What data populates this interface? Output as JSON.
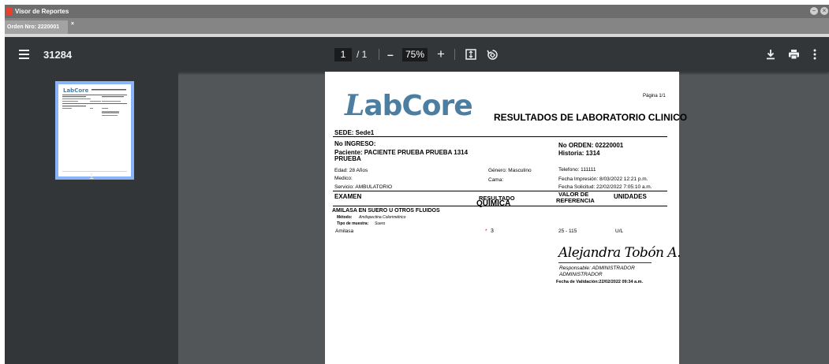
{
  "window": {
    "title": "Visor de Reportes",
    "tab": "Orden Nro: 2220001",
    "tab_close": "×",
    "minimize": "–",
    "close": "×"
  },
  "toolbar": {
    "doc_title": "31284",
    "page_current": "1",
    "page_total": "/ 1",
    "zoom_out": "–",
    "zoom_value": "75%",
    "zoom_in": "+",
    "fit_icon": "fit-page-icon",
    "rotate_icon": "rotate-icon",
    "download_icon": "download-icon",
    "print_icon": "print-icon",
    "more_icon": "more-vert-icon"
  },
  "sidebar": {
    "thumb_number": "1"
  },
  "report": {
    "page_label": "Página 1/1",
    "logo": "LabCore",
    "heading": "RESULTADOS DE LABORATORIO CLINICO",
    "sede": "SEDE: Sede1",
    "no_ingreso": "No INGRESO:",
    "no_orden": "No ORDEN: 02220001",
    "paciente_line1": "Paciente: PACIENTE PRUEBA  PRUEBA  1314",
    "paciente_line2": "PRUEBA",
    "historia": "Historia: 1314",
    "edad": "Edad: 28 Años",
    "genero": "Género: Masculino",
    "telefono": "Telefono: 111111",
    "medico": "Medico:",
    "cama": "Cama:",
    "fecha_impresion": "Fecha Impresión: 8/03/2022   12:21 p.m.",
    "servicio": "Servicio: AMBULATORIO",
    "fecha_solicitud": "Fecha Solicitud: 22/02/2022 7:05:10 a.m.",
    "col_examen": "EXAMEN",
    "col_resultado": "RESULTADO",
    "col_valor_1": "VALOR DE",
    "col_valor_2": "REFERENCIA",
    "col_unidades": "UNIDADES",
    "section": "QUÍMICA",
    "test_group": "AMILASA EN SUERO U OTROS FLUIDOS",
    "metodo_label": "Método:",
    "metodo_value": "Amilopectina Colorimétrico",
    "muestra_label": "Tipo de muestra:",
    "muestra_value": "Suero",
    "test_name": "Amilasa",
    "test_flag": "*",
    "test_value": "3",
    "test_range": "25 - 115",
    "test_unit": "U/L",
    "signature": "Alejandra Tobón A.",
    "responsable_1": "Responsable: ADMINISTRADOR",
    "responsable_2": "ADMINISTRADOR",
    "validacion": "Fecha de Validación:22/02/2022 09:34 a.m."
  },
  "colors": {
    "accent": "#8ab4f8",
    "logo": "#4c7ea2",
    "toolbar": "#323639",
    "viewer_bg": "#525659"
  }
}
